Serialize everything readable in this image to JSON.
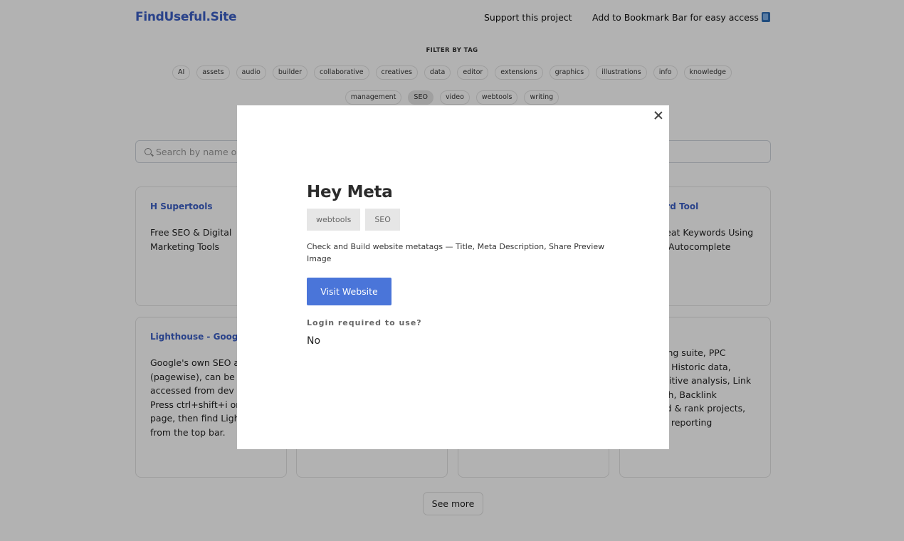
{
  "header": {
    "logo": "FindUseful.Site",
    "support_link": "Support this project",
    "bookmark_link": "Add to Bookmark Bar for easy access"
  },
  "filter": {
    "label": "FILTER BY TAG",
    "tags_row1": [
      "AI",
      "assets",
      "audio",
      "builder",
      "collaborative",
      "creatives",
      "data",
      "editor",
      "extensions",
      "graphics",
      "illustrations",
      "info",
      "knowledge"
    ],
    "tags_row2": [
      "management",
      "SEO",
      "video",
      "webtools",
      "writing"
    ],
    "active_tag": "SEO"
  },
  "search": {
    "placeholder": "Search by name or description"
  },
  "cards": [
    {
      "title": "H Supertools",
      "desc": "Free SEO & Digital Marketing Tools"
    },
    {
      "title": "",
      "desc": ""
    },
    {
      "title": "",
      "desc": ""
    },
    {
      "title": "Keyword Tool",
      "desc": "Find Great Keywords Using Google Autocomplete"
    },
    {
      "title": "Lighthouse - Google",
      "desc": "Google's own SEO analysis (pagewise), can be accessed from dev tools. Press ctrl+shift+i on the page, then find Lighthouse from the top bar."
    },
    {
      "title": "",
      "desc": ""
    },
    {
      "title": "",
      "desc": ""
    },
    {
      "title": "",
      "desc": "Marketing suite, PPC tracker, Historic data, Competitive analysis, Link outreach, Backlink keyword & rank projects, Custom reporting"
    }
  ],
  "see_more": "See more",
  "modal": {
    "title": "Hey Meta",
    "tags": [
      "webtools",
      "SEO"
    ],
    "description": "Check and Build website metatags — Title, Meta Description, Share Preview Image",
    "visit_button": "Visit Website",
    "login_label": "Login required to use?",
    "login_value": "No"
  }
}
